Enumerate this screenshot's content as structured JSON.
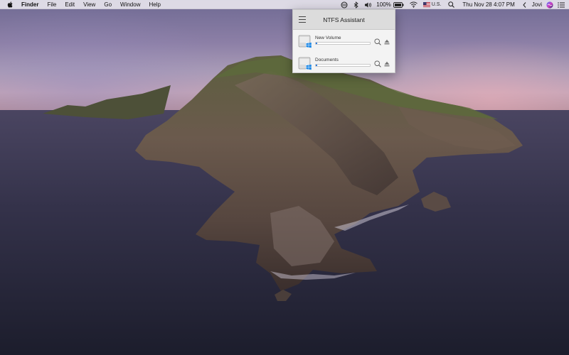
{
  "menubar": {
    "app_name": "Finder",
    "menus": [
      "File",
      "Edit",
      "View",
      "Go",
      "Window",
      "Help"
    ],
    "battery": "100%",
    "input_source": "U.S.",
    "datetime": "Thu Nov 28  4:07 PM",
    "user": "Jovi",
    "icons": [
      "apple-icon",
      "vpn-icon",
      "bluetooth-icon",
      "volume-icon",
      "battery-icon",
      "wifi-icon",
      "flag-icon",
      "spotlight-icon",
      "chevron-left-icon",
      "siri-icon",
      "notification-center-icon"
    ]
  },
  "popover": {
    "title": "NTFS Assistant",
    "volumes": [
      {
        "name": "New Volume",
        "usage_fraction": 0.02
      },
      {
        "name": "Documents",
        "usage_fraction": 0.02
      }
    ],
    "accent_color": "#2d7be0"
  }
}
